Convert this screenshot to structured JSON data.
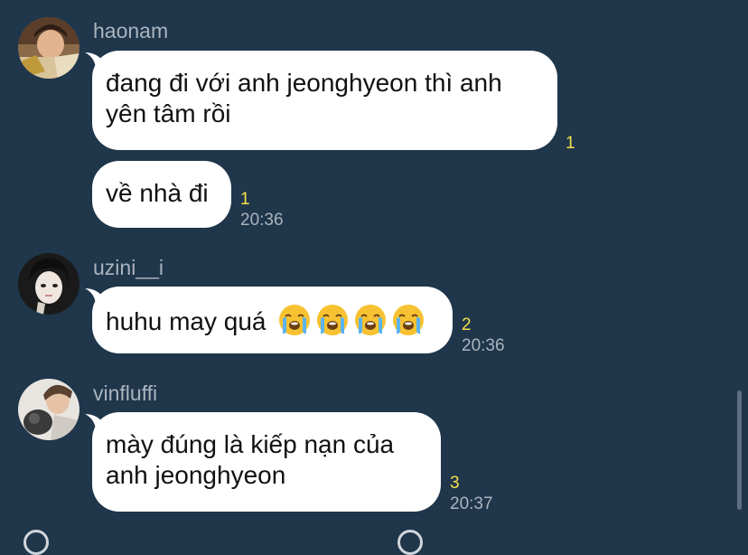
{
  "messages": [
    {
      "user": "haonam",
      "bubbles": [
        {
          "text": "đang đi với anh jeonghyeon thì anh\nyên tâm rồi",
          "read": "1",
          "time": ""
        },
        {
          "text": "về nhà đi",
          "read": "1",
          "time": "20:36"
        }
      ]
    },
    {
      "user": "uzini__i",
      "bubbles": [
        {
          "text": "huhu may quá",
          "emoji": "loudly-crying-face",
          "emoji_count": 4,
          "read": "2",
          "time": "20:36"
        }
      ]
    },
    {
      "user": "vinfluffi",
      "bubbles": [
        {
          "text": "mày đúng là kiếp nạn của\nanh jeonghyeon",
          "read": "3",
          "time": "20:37"
        }
      ]
    }
  ],
  "colors": {
    "background": "#1f364b",
    "bubble": "#ffffff",
    "read_count": "#f5e04a",
    "meta_text": "#aab4be"
  }
}
